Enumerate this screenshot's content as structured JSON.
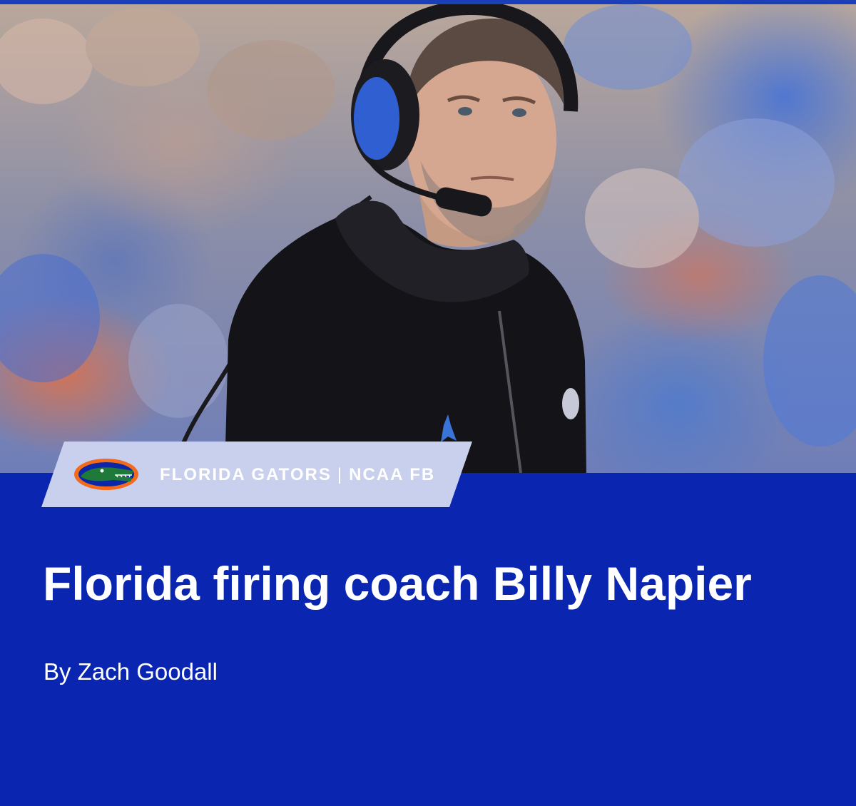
{
  "article": {
    "category": {
      "team": "FLORIDA GATORS",
      "separator": "|",
      "league": "NCAA FB",
      "logo_icon": "gator-logo-icon"
    },
    "headline": "Florida firing coach Billy Napier",
    "byline": "By Zach Goodall",
    "hero_image": "coach-photo"
  },
  "colors": {
    "background": "#0a26b1",
    "tag_background": "#c9d0ee",
    "text": "#ffffff",
    "gator_orange": "#f26b1d",
    "gator_green": "#1f7a3a"
  }
}
